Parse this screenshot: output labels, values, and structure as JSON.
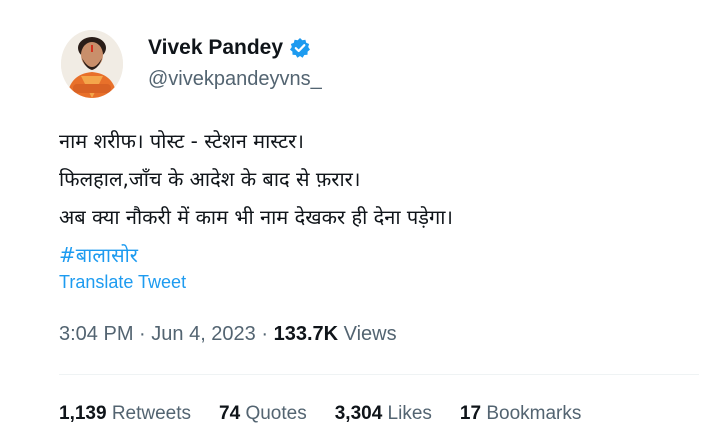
{
  "author": {
    "name": "Vivek Pandey",
    "handle": "@vivekpandeyvns_",
    "verified_icon": "verified-badge-icon",
    "avatar_icon": "profile-photo"
  },
  "tweet": {
    "lines": [
      "नाम शरीफ। पोस्ट - स्टेशन मास्टर।",
      "फिलहाल,जाँच के आदेश के बाद से फ़रार।",
      "अब क्या नौकरी में काम भी नाम देखकर ही देना पड़ेगा।"
    ],
    "hashtag": "#बालासोर",
    "translate_label": "Translate Tweet"
  },
  "meta": {
    "time": "3:04 PM",
    "separator1": " · ",
    "date": "Jun 4, 2023",
    "separator2": " · ",
    "views_count": "133.7K",
    "views_label": " Views"
  },
  "stats": {
    "retweets": {
      "count": "1,139",
      "label": " Retweets"
    },
    "quotes": {
      "count": "74",
      "label": " Quotes"
    },
    "likes": {
      "count": "3,304",
      "label": " Likes"
    },
    "bookmarks": {
      "count": "17",
      "label": " Bookmarks"
    }
  },
  "colors": {
    "link": "#1d9bf0",
    "secondary_text": "#536471",
    "primary_text": "#0f1419",
    "divider": "#eff3f4"
  }
}
